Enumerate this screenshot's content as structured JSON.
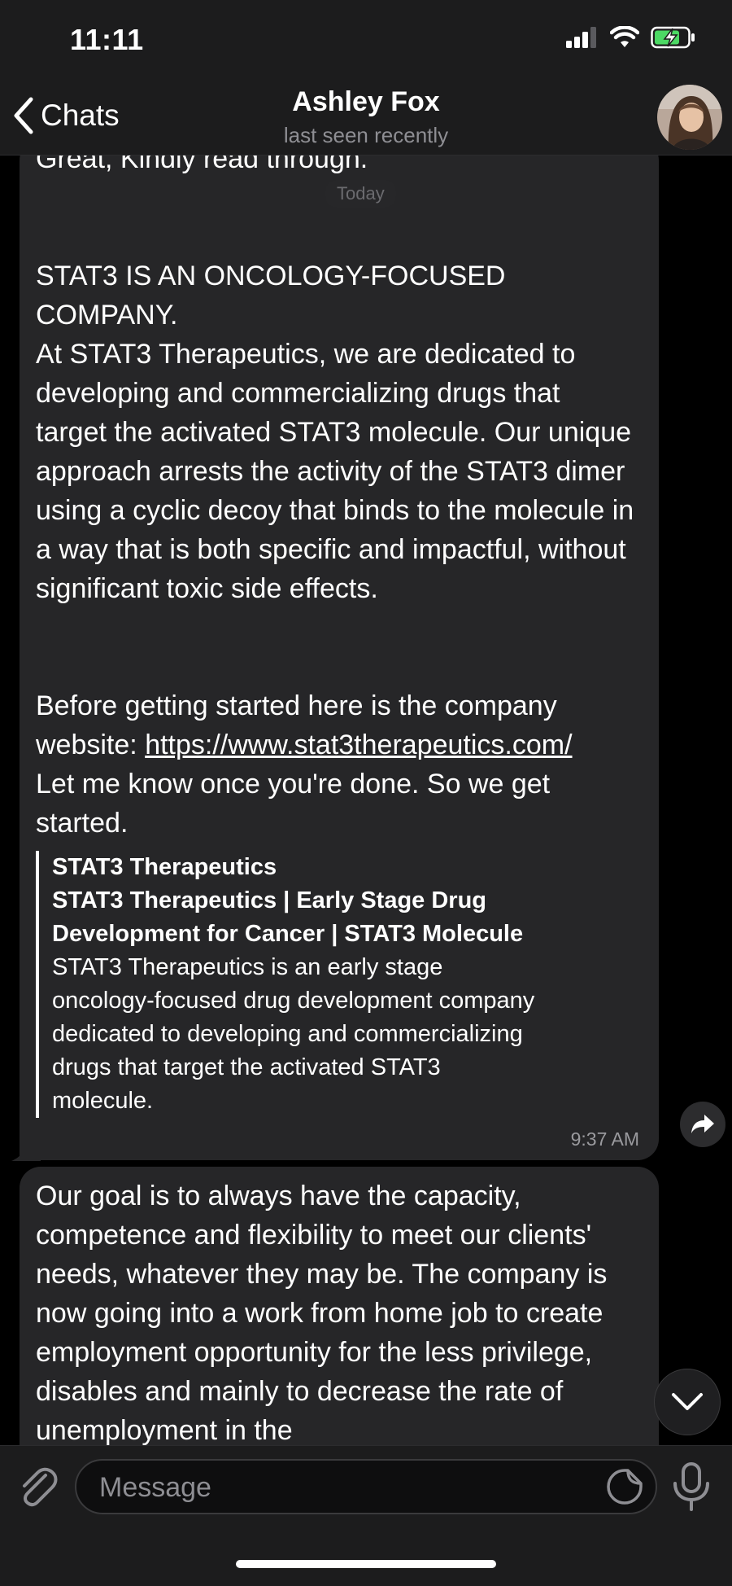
{
  "status_bar": {
    "time": "11:11"
  },
  "header": {
    "back_label": "Chats",
    "name": "Ashley Fox",
    "subtitle": "last seen recently"
  },
  "date_chip": "Today",
  "messages": [
    {
      "text_before": "Great, Kindly read through.\n\n\nSTAT3 IS AN ONCOLOGY-FOCUSED COMPANY.\nAt STAT3 Therapeutics, we are dedicated to developing and commercializing drugs that target the activated STAT3 molecule. Our unique approach arrests the activity of the STAT3 dimer using a cyclic decoy that binds to the molecule in a way that is both specific and impactful, without significant toxic side effects.\n\n\nBefore getting started here is the company website: ",
      "link": "https://www.stat3therapeutics.com/",
      "text_after": "\nLet me know once you're done. So we get started.",
      "preview": {
        "site": "STAT3 Therapeutics",
        "title": "STAT3 Therapeutics | Early Stage Drug Development for Cancer | STAT3 Molecule",
        "description": "STAT3 Therapeutics is an early stage oncology-focused drug development company dedicated to developing and commercializing drugs that target the activated STAT3 molecule."
      },
      "time": "9:37 AM"
    },
    {
      "text": "Our goal is to always have the capacity, competence and flexibility to meet our clients' needs, whatever they may be. The company is now going into a work from home job to create employment opportunity for the less privilege, disables and mainly to decrease the rate of unemployment in the"
    }
  ],
  "input": {
    "placeholder": "Message",
    "value": ""
  },
  "colors": {
    "background": "#000000",
    "bubble": "#262628",
    "bar": "#1c1c1d",
    "battery": "#4cd964"
  },
  "icons": [
    "signal-icon",
    "wifi-icon",
    "battery-charging-icon",
    "back-chevron-icon",
    "forward-icon",
    "chevron-down-icon",
    "paperclip-icon",
    "sticker-icon",
    "microphone-icon"
  ]
}
